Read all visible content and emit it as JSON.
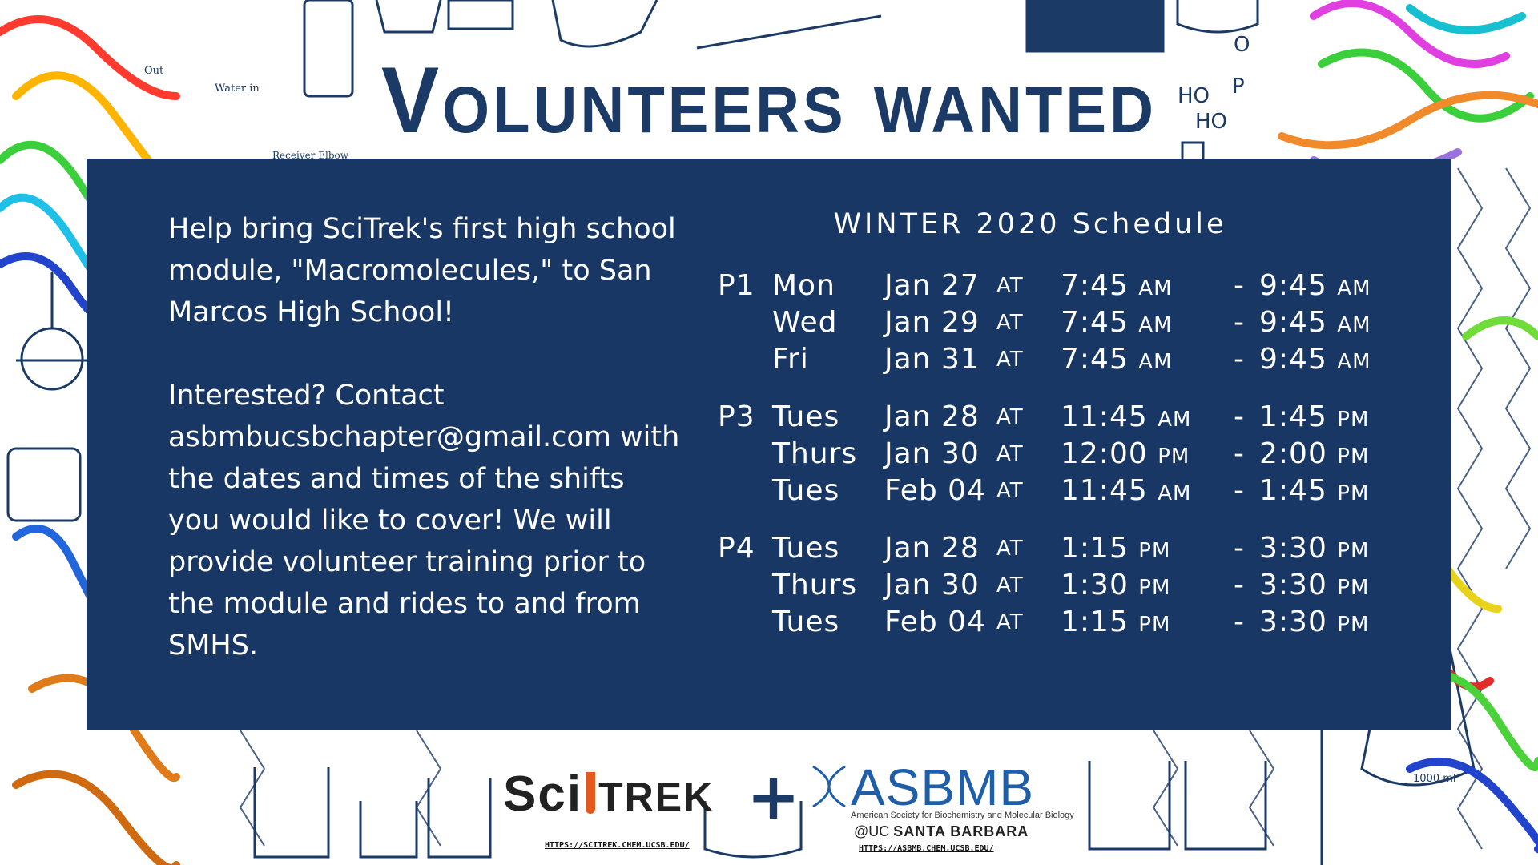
{
  "title": "Volunteers wanted",
  "intro": {
    "para1": "Help bring SciTrek's first high school module, \"Macromolecules,\" to San Marcos High School!",
    "para2": "Interested? Contact asbmbucsbchapter@gmail.com with the dates and times of the shifts you would like to cover! We will provide volunteer training prior to the module and rides to and from SMHS."
  },
  "schedule": {
    "title": "WINTER 2020 Schedule",
    "at_label": "AT",
    "groups": [
      {
        "period": "P1",
        "rows": [
          {
            "day": "Mon",
            "date": "Jan 27",
            "start": "7:45",
            "start_suffix": "AM",
            "end": "9:45",
            "end_suffix": "AM"
          },
          {
            "day": "Wed",
            "date": "Jan 29",
            "start": "7:45",
            "start_suffix": "AM",
            "end": "9:45",
            "end_suffix": "AM"
          },
          {
            "day": "Fri",
            "date": "Jan 31",
            "start": "7:45",
            "start_suffix": "AM",
            "end": "9:45",
            "end_suffix": "AM"
          }
        ]
      },
      {
        "period": "P3",
        "rows": [
          {
            "day": "Tues",
            "date": "Jan 28",
            "start": "11:45",
            "start_suffix": "AM",
            "end": "1:45",
            "end_suffix": "PM"
          },
          {
            "day": "Thurs",
            "date": "Jan 30",
            "start": "12:00",
            "start_suffix": "PM",
            "end": "2:00",
            "end_suffix": "PM"
          },
          {
            "day": "Tues",
            "date": "Feb 04",
            "start": "11:45",
            "start_suffix": "AM",
            "end": "1:45",
            "end_suffix": "PM"
          }
        ]
      },
      {
        "period": "P4",
        "rows": [
          {
            "day": "Tues",
            "date": "Jan 28",
            "start": "1:15",
            "start_suffix": "PM",
            "end": "3:30",
            "end_suffix": "PM"
          },
          {
            "day": "Thurs",
            "date": "Jan 30",
            "start": "1:30",
            "start_suffix": "PM",
            "end": "3:30",
            "end_suffix": "PM"
          },
          {
            "day": "Tues",
            "date": "Feb 04",
            "start": "1:15",
            "start_suffix": "PM",
            "end": "3:30",
            "end_suffix": "PM"
          }
        ]
      }
    ]
  },
  "logos": {
    "scitrek_sci": "Sci",
    "scitrek_trek": "TREK",
    "scitrek_url": "HTTPS://SCITREK.CHEM.UCSB.EDU/",
    "plus": "+",
    "asbmb_name": "ASBMB",
    "asbmb_full": "American Society for Biochemistry and Molecular Biology",
    "asbmb_at": "@UC",
    "asbmb_campus": "SANTA BARBARA",
    "asbmb_url": "HTTPS://ASBMB.CHEM.UCSB.EDU/"
  },
  "decor": {
    "water_in": "Water in",
    "out": "Out",
    "receiver_elbow": "Receiver Elbow",
    "beaker_volume": "1000 ml",
    "ho1": "HO",
    "ho2": "HO",
    "p": "P",
    "o": "O"
  },
  "colors": {
    "navy": "#183764",
    "title": "#1b3a66",
    "asbmb_blue": "#1f5ea8",
    "scitrek_orange": "#e55a1c"
  }
}
